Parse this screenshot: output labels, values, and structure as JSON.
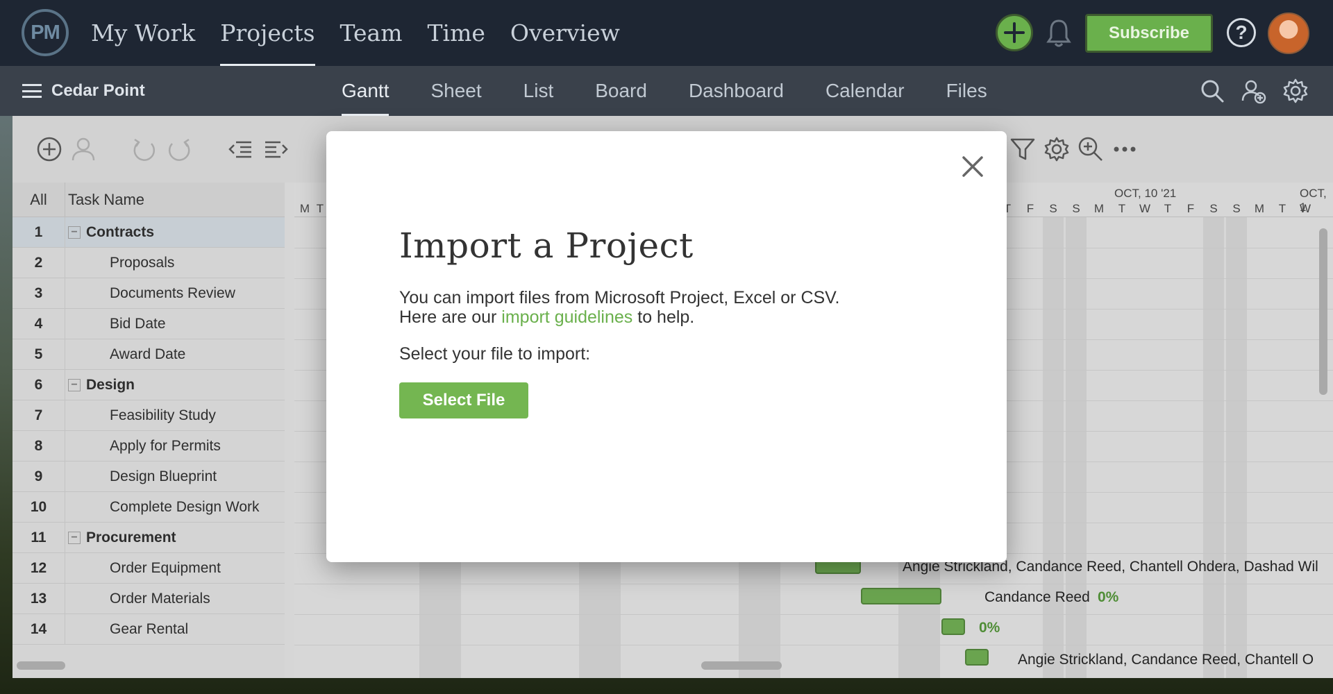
{
  "app": {
    "logo_text": "PM",
    "nav": [
      "My Work",
      "Projects",
      "Team",
      "Time",
      "Overview"
    ],
    "active_nav": "Projects",
    "subscribe_label": "Subscribe",
    "help_label": "?"
  },
  "project": {
    "name": "Cedar Point",
    "view_tabs": [
      "Gantt",
      "Sheet",
      "List",
      "Board",
      "Dashboard",
      "Calendar",
      "Files"
    ],
    "active_tab": "Gantt"
  },
  "grid": {
    "headers": {
      "all": "All",
      "task_name": "Task Name"
    },
    "rows": [
      {
        "num": "1",
        "name": "Contracts",
        "group": true
      },
      {
        "num": "2",
        "name": "Proposals"
      },
      {
        "num": "3",
        "name": "Documents Review"
      },
      {
        "num": "4",
        "name": "Bid Date"
      },
      {
        "num": "5",
        "name": "Award Date"
      },
      {
        "num": "6",
        "name": "Design",
        "group": true
      },
      {
        "num": "7",
        "name": "Feasibility Study"
      },
      {
        "num": "8",
        "name": "Apply for Permits"
      },
      {
        "num": "9",
        "name": "Design Blueprint"
      },
      {
        "num": "10",
        "name": "Complete Design Work"
      },
      {
        "num": "11",
        "name": "Procurement",
        "group": true
      },
      {
        "num": "12",
        "name": "Order Equipment"
      },
      {
        "num": "13",
        "name": "Order Materials"
      },
      {
        "num": "14",
        "name": "Gear Rental"
      }
    ]
  },
  "gantt": {
    "months": [
      "OCT, 10 '21",
      "OCT, 1"
    ],
    "days_left": [
      "M",
      "T"
    ],
    "days_right": [
      "T",
      "F",
      "S",
      "S",
      "M",
      "T",
      "W",
      "T",
      "F",
      "S",
      "S",
      "M",
      "T",
      "W"
    ],
    "labels": {
      "row12": "Angie Strickland, Candance Reed, Chantell Ohdera, Dashad Wil",
      "row13": "Candance Reed",
      "row13_pct": "0%",
      "row14_pct": "0%",
      "row15": "Angie Strickland, Candance Reed, Chantell O"
    }
  },
  "modal": {
    "title": "Import a Project",
    "desc_line1": "You can import files from Microsoft Project, Excel or CSV.",
    "desc_line2_pre": "Here are our ",
    "desc_link": "import guidelines",
    "desc_line2_post": " to help.",
    "prompt": "Select your file to import:",
    "button": "Select File"
  },
  "colors": {
    "accent": "#6ab04c",
    "topbar": "#1e2633",
    "subbar": "#3a414b"
  }
}
